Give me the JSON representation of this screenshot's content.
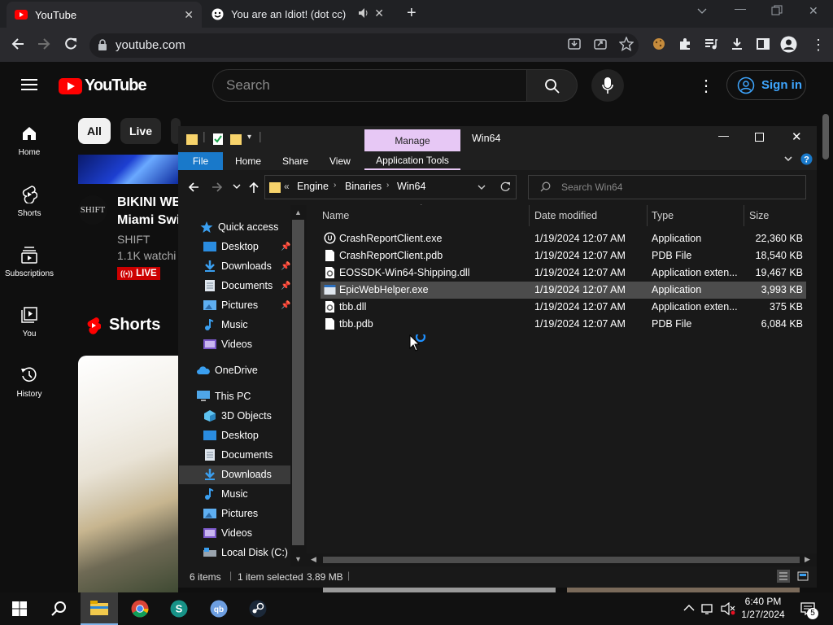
{
  "browser": {
    "tabs": [
      {
        "title": "YouTube"
      },
      {
        "title": "You are an Idiot! (dot cc)"
      }
    ],
    "url": "youtube.com"
  },
  "youtube": {
    "logo_text": "YouTube",
    "search_placeholder": "Search",
    "signin_label": "Sign in",
    "sidebar": [
      {
        "label": "Home"
      },
      {
        "label": "Shorts"
      },
      {
        "label": "Subscriptions"
      },
      {
        "label": "You"
      },
      {
        "label": "History"
      }
    ],
    "chips": [
      {
        "label": "All"
      },
      {
        "label": "Live"
      }
    ],
    "live_video": {
      "channel_logo": "SHIFT",
      "title_line1": "BIKINI WE",
      "title_line2": "Miami Swi",
      "channel": "SHIFT",
      "watching": "1.1K watchi",
      "badge": "LIVE"
    },
    "shorts_label": "Shorts"
  },
  "explorer": {
    "window_title": "Win64",
    "ribbon_tabs": {
      "file": "File",
      "home": "Home",
      "share": "Share",
      "view": "View",
      "manage": "Manage",
      "app_tools": "Application Tools"
    },
    "path": {
      "overflow": "«",
      "parts": [
        "Engine",
        "Binaries",
        "Win64"
      ]
    },
    "search_placeholder": "Search Win64",
    "nav": {
      "quick_access": "Quick access",
      "quick_items": [
        {
          "label": "Desktop"
        },
        {
          "label": "Downloads"
        },
        {
          "label": "Documents"
        },
        {
          "label": "Pictures"
        },
        {
          "label": "Music"
        },
        {
          "label": "Videos"
        }
      ],
      "onedrive": "OneDrive",
      "this_pc": "This PC",
      "pc_items": [
        {
          "label": "3D Objects"
        },
        {
          "label": "Desktop"
        },
        {
          "label": "Documents"
        },
        {
          "label": "Downloads"
        },
        {
          "label": "Music"
        },
        {
          "label": "Pictures"
        },
        {
          "label": "Videos"
        },
        {
          "label": "Local Disk (C:)"
        }
      ]
    },
    "columns": {
      "name": "Name",
      "date": "Date modified",
      "type": "Type",
      "size": "Size"
    },
    "files": [
      {
        "name": "CrashReportClient.exe",
        "date": "1/19/2024 12:07 AM",
        "type": "Application",
        "size": "22,360 KB"
      },
      {
        "name": "CrashReportClient.pdb",
        "date": "1/19/2024 12:07 AM",
        "type": "PDB File",
        "size": "18,540 KB"
      },
      {
        "name": "EOSSDK-Win64-Shipping.dll",
        "date": "1/19/2024 12:07 AM",
        "type": "Application exten...",
        "size": "19,467 KB"
      },
      {
        "name": "EpicWebHelper.exe",
        "date": "1/19/2024 12:07 AM",
        "type": "Application",
        "size": "3,993 KB"
      },
      {
        "name": "tbb.dll",
        "date": "1/19/2024 12:07 AM",
        "type": "Application exten...",
        "size": "375 KB"
      },
      {
        "name": "tbb.pdb",
        "date": "1/19/2024 12:07 AM",
        "type": "PDB File",
        "size": "6,084 KB"
      }
    ],
    "status": {
      "items": "6 items",
      "selected": "1 item selected",
      "size": "3.89 MB"
    }
  },
  "taskbar": {
    "time": "6:40 PM",
    "date": "1/27/2024",
    "notification_count": "5"
  },
  "colors": {
    "yt_red": "#ff0000",
    "accent_blue": "#3ea6ff",
    "manage_tab": "#e7c8f5",
    "file_tab": "#1979ca"
  }
}
